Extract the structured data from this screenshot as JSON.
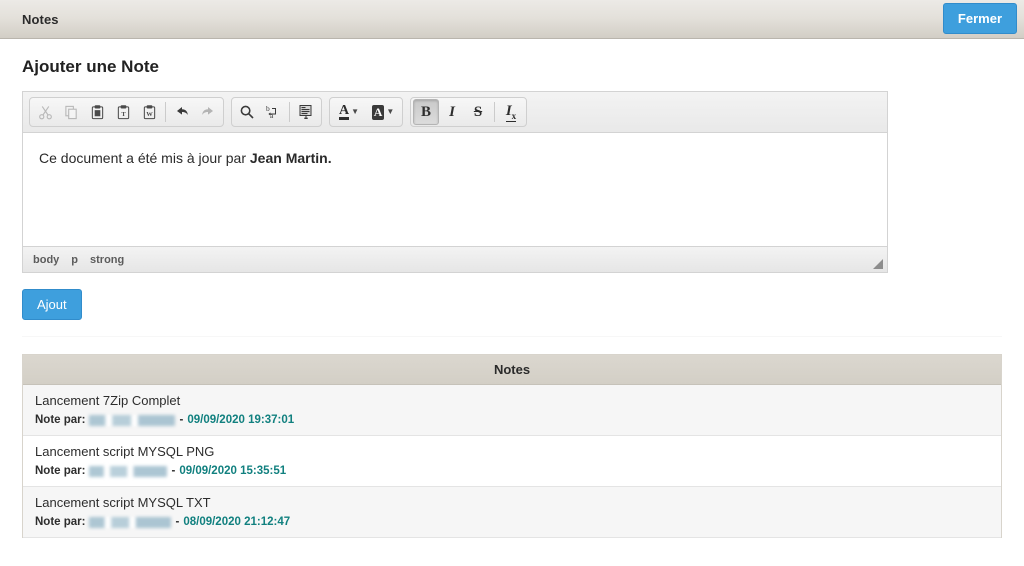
{
  "window": {
    "title": "Notes",
    "close_label": "Fermer",
    "accent_color": "#3e9fdd",
    "header_bg": "#e4e1db"
  },
  "form": {
    "section_title": "Ajouter une Note",
    "submit_label": "Ajout",
    "editor": {
      "content_prefix": "Ce document a été mis à jour par ",
      "content_bold": "Jean Martin.",
      "element_path": [
        "body",
        "p",
        "strong"
      ],
      "toolbar": {
        "groups": [
          {
            "name": "clipboard",
            "buttons": [
              {
                "name": "cut-icon",
                "label": "Couper",
                "state": "disabled"
              },
              {
                "name": "copy-icon",
                "label": "Copier",
                "state": "disabled"
              },
              {
                "name": "paste-icon",
                "label": "Coller",
                "state": "normal"
              },
              {
                "name": "paste-text-icon",
                "label": "Coller comme texte brut",
                "state": "normal"
              },
              {
                "name": "paste-word-icon",
                "label": "Coller depuis Word",
                "state": "normal"
              },
              {
                "name": "undo-icon",
                "label": "Annuler",
                "state": "normal"
              },
              {
                "name": "redo-icon",
                "label": "Rétablir",
                "state": "disabled"
              }
            ]
          },
          {
            "name": "editing",
            "buttons": [
              {
                "name": "search-icon",
                "label": "Rechercher",
                "state": "normal"
              },
              {
                "name": "replace-icon",
                "label": "Remplacer",
                "state": "normal"
              },
              {
                "name": "select-all-icon",
                "label": "Tout sélectionner",
                "state": "normal"
              }
            ]
          },
          {
            "name": "colors",
            "buttons": [
              {
                "name": "text-color-icon",
                "label": "Couleur de texte",
                "state": "normal"
              },
              {
                "name": "background-color-icon",
                "label": "Couleur d'arrière-plan",
                "state": "normal"
              }
            ]
          },
          {
            "name": "basic-styles",
            "buttons": [
              {
                "name": "bold-icon",
                "label": "Gras",
                "state": "active"
              },
              {
                "name": "italic-icon",
                "label": "Italique",
                "state": "normal"
              },
              {
                "name": "strike-icon",
                "label": "Barré",
                "state": "normal"
              },
              {
                "name": "remove-format-icon",
                "label": "Supprimer la mise en forme",
                "state": "normal"
              }
            ]
          }
        ]
      }
    }
  },
  "notes_table": {
    "header": "Notes",
    "date_color": "#11807f",
    "meta_label": "Note par:",
    "separator": "-",
    "rows": [
      {
        "title": "Lancement 7Zip Complet",
        "author": "[redacted]",
        "date": "09/09/2020 19:37:01"
      },
      {
        "title": "Lancement script MYSQL PNG",
        "author": "[redacted]",
        "date": "09/09/2020 15:35:51"
      },
      {
        "title": "Lancement script MYSQL TXT",
        "author": "[redacted]",
        "date": "08/09/2020 21:12:47"
      }
    ]
  }
}
